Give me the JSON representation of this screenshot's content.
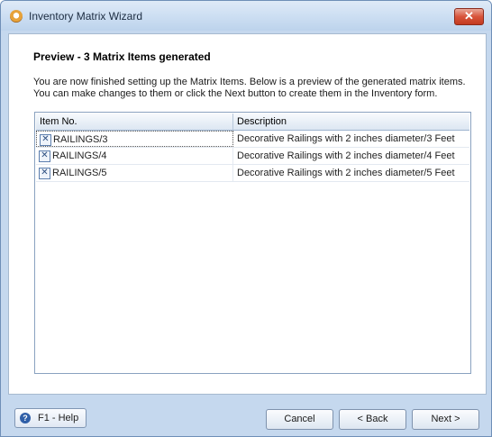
{
  "window": {
    "title": "Inventory Matrix Wizard",
    "close_label": "✕"
  },
  "content": {
    "heading": "Preview - 3 Matrix Items generated",
    "description_line1": "You are now finished setting up the Matrix Items.  Below is a preview of the generated matrix items.",
    "description_line2": "You can make changes to them or click the Next button to create them in the Inventory form."
  },
  "grid": {
    "columns": [
      "Item No.",
      "Description"
    ],
    "rows": [
      {
        "item_no": "RAILINGS/3",
        "description": "Decorative Railings with 2 inches diameter/3 Feet",
        "selected": true
      },
      {
        "item_no": "RAILINGS/4",
        "description": "Decorative Railings with 2 inches diameter/4 Feet",
        "selected": false
      },
      {
        "item_no": "RAILINGS/5",
        "description": "Decorative Railings with 2 inches diameter/5 Feet",
        "selected": false
      }
    ],
    "delete_icon_glyph": "✕"
  },
  "footer": {
    "help_label": "F1 -  Help",
    "help_icon_glyph": "?",
    "cancel_label": "Cancel",
    "back_label": "< Back",
    "next_label": "Next >"
  }
}
